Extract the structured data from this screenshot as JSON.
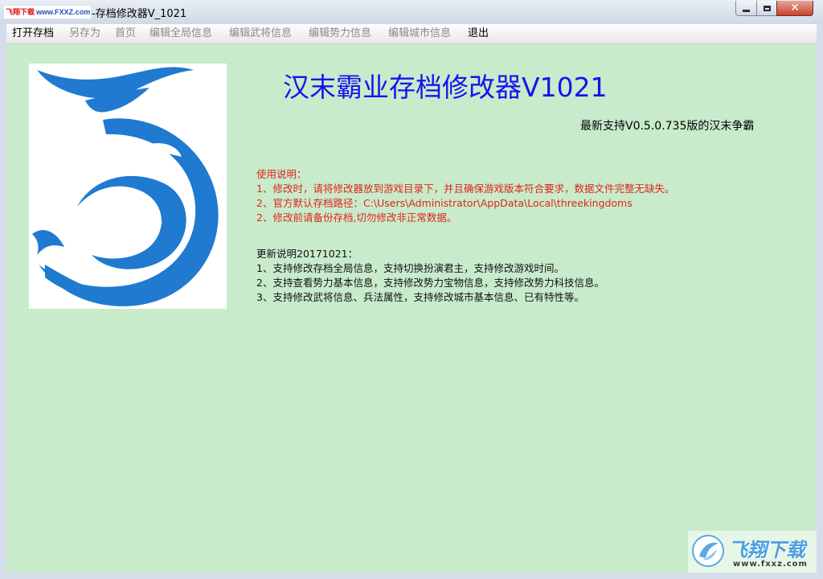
{
  "window": {
    "title": "-存档修改器V_1021",
    "watermark_top": {
      "site_name": "飞翔下载",
      "url": "www.FXXZ.com"
    }
  },
  "menu": {
    "items": [
      {
        "label": "打开存档",
        "enabled": true
      },
      {
        "label": "另存为",
        "enabled": false
      },
      {
        "label": "首页",
        "enabled": false
      },
      {
        "label": "编辑全局信息",
        "enabled": false
      },
      {
        "label": "编辑武将信息",
        "enabled": false
      },
      {
        "label": "编辑势力信息",
        "enabled": false
      },
      {
        "label": "编辑城市信息",
        "enabled": false
      },
      {
        "label": "退出",
        "enabled": true
      }
    ]
  },
  "main": {
    "title": "汉末霸业存档修改器V1021",
    "support": "最新支持V0.5.0.735版的汉末争霸",
    "usage": {
      "heading": "使用说明：",
      "lines": [
        "1、修改时，请将修改器放到游戏目录下，并且确保游戏版本符合要求，数据文件完整无缺失。",
        "2、官方默认存档路径：C:\\Users\\Administrator\\AppData\\Local\\threekingdoms",
        "2、修改前请备份存档,切勿修改非正常数据。"
      ]
    },
    "update": {
      "heading": "更新说明20171021：",
      "lines": [
        "1、支持修改存档全局信息，支持切换扮演君主，支持修改游戏时间。",
        "2、支持查看势力基本信息，支持修改势力宝物信息，支持修改势力科技信息。",
        "3、支持修改武将信息、兵法属性，支持修改城市基本信息、已有特性等。"
      ]
    }
  },
  "watermark_bottom": {
    "title": "飞翔下载",
    "url": "www.fxxz.com"
  },
  "colors": {
    "content_bg": "#c8ebcb",
    "title_blue": "#1414ee",
    "note_red": "#e2241b",
    "logo_blue": "#1f7ad0"
  }
}
